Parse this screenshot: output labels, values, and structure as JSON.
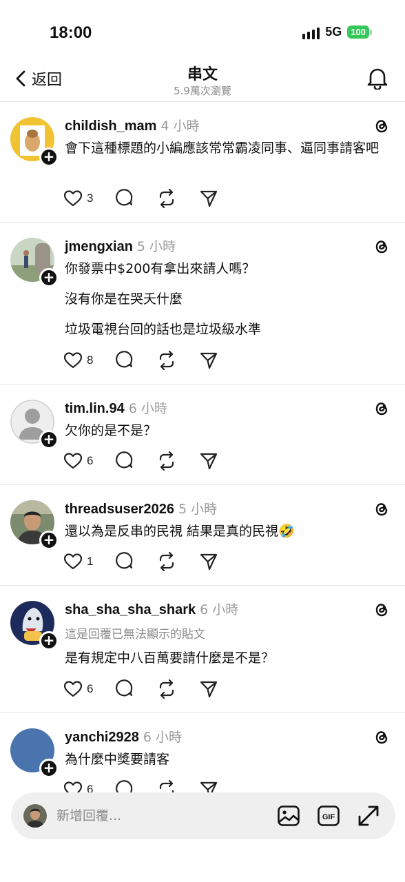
{
  "status": {
    "time": "18:00",
    "network": "5G",
    "battery": "100"
  },
  "header": {
    "back_label": "返回",
    "title": "串文",
    "subtitle": "5.9萬次瀏覽"
  },
  "replies": [
    {
      "username": "childish_mam",
      "time": "4 小時",
      "lines": [
        "會下這種標題的小編應該常常霸凌同事、逼同事請客吧"
      ],
      "note": "",
      "likes": "3"
    },
    {
      "username": "jmengxian",
      "time": "5 小時",
      "lines": [
        "你發票中$200有拿出來請人嗎？",
        "沒有你是在哭夭什麼",
        "垃圾電視台回的話也是垃圾級水準"
      ],
      "note": "",
      "likes": "8"
    },
    {
      "username": "tim.lin.94",
      "time": "6 小時",
      "lines": [
        "欠你的是不是？"
      ],
      "note": "",
      "likes": "6"
    },
    {
      "username": "threadsuser2026",
      "time": "5 小時",
      "lines": [
        "還以為是反串的民視 結果是真的民視🤣"
      ],
      "note": "",
      "likes": "1"
    },
    {
      "username": "sha_sha_sha_shark",
      "time": "6 小時",
      "lines": [
        "是有規定中八百萬要請什麼是不是？"
      ],
      "note": "這是回覆已無法顯示的貼文",
      "likes": "6"
    },
    {
      "username": "yanchi2928",
      "time": "6 小時",
      "lines": [
        "為什麼中獎要請客"
      ],
      "note": "",
      "likes": "6"
    }
  ],
  "composer": {
    "placeholder": "新增回覆..."
  },
  "icons": {
    "back": "chevron-left-icon",
    "bell": "bell-icon",
    "threads": "threads-logo-icon",
    "like": "heart-icon",
    "comment": "comment-icon",
    "repost": "repost-icon",
    "share": "send-icon",
    "image": "image-icon",
    "gif": "gif-icon",
    "expand": "expand-icon"
  }
}
